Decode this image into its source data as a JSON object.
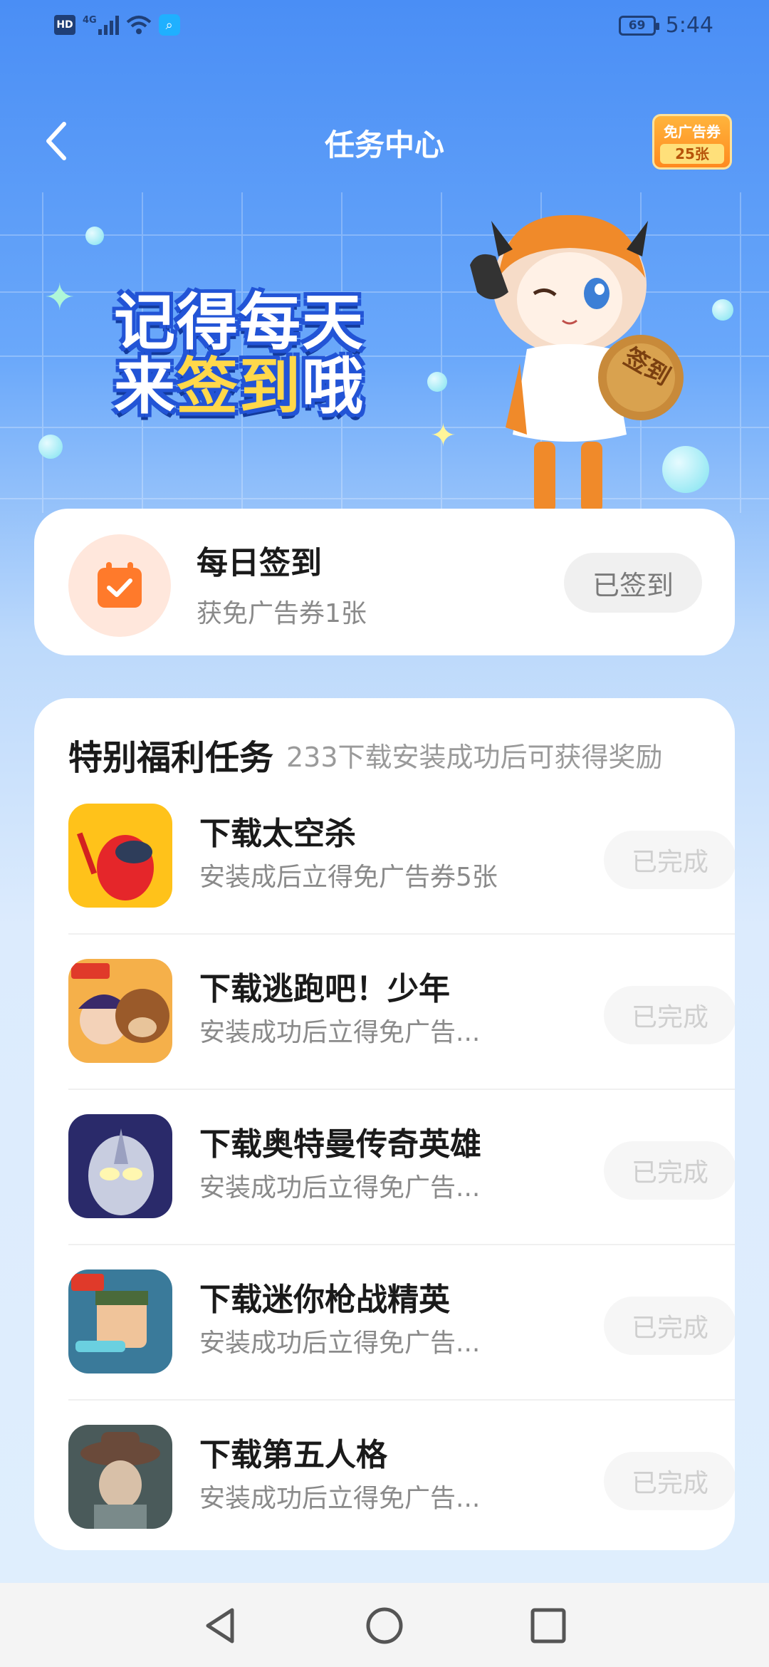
{
  "status_bar": {
    "hd": "HD",
    "network": "4G",
    "battery": "69",
    "time": "5:44"
  },
  "header": {
    "title": "任务中心",
    "coupon_label": "免广告券",
    "coupon_count": "25张"
  },
  "banner": {
    "line1": "记得每天",
    "line2_a": "来",
    "line2_b": "签到",
    "line2_c": "哦",
    "coin_text": "签到"
  },
  "daily": {
    "title": "每日签到",
    "subtitle": "获免广告券1张",
    "button": "已签到"
  },
  "special": {
    "title": "特别福利任务",
    "note": "233下载安装成功后可获得奖励",
    "tasks": [
      {
        "title": "下载太空杀",
        "subtitle": "安装成后立得免广告券5张",
        "button": "已完成"
      },
      {
        "title": "下载逃跑吧！少年",
        "subtitle": "安装成功后立得免广告...",
        "button": "已完成"
      },
      {
        "title": "下载奥特曼传奇英雄",
        "subtitle": "安装成功后立得免广告...",
        "button": "已完成"
      },
      {
        "title": "下载迷你枪战精英",
        "subtitle": "安装成功后立得免广告...",
        "button": "已完成"
      },
      {
        "title": "下载第五人格",
        "subtitle": "安装成功后立得免广告...",
        "button": "已完成"
      }
    ]
  },
  "colors": {
    "accent": "#4a8ef5",
    "orange": "#ff7a2b"
  }
}
